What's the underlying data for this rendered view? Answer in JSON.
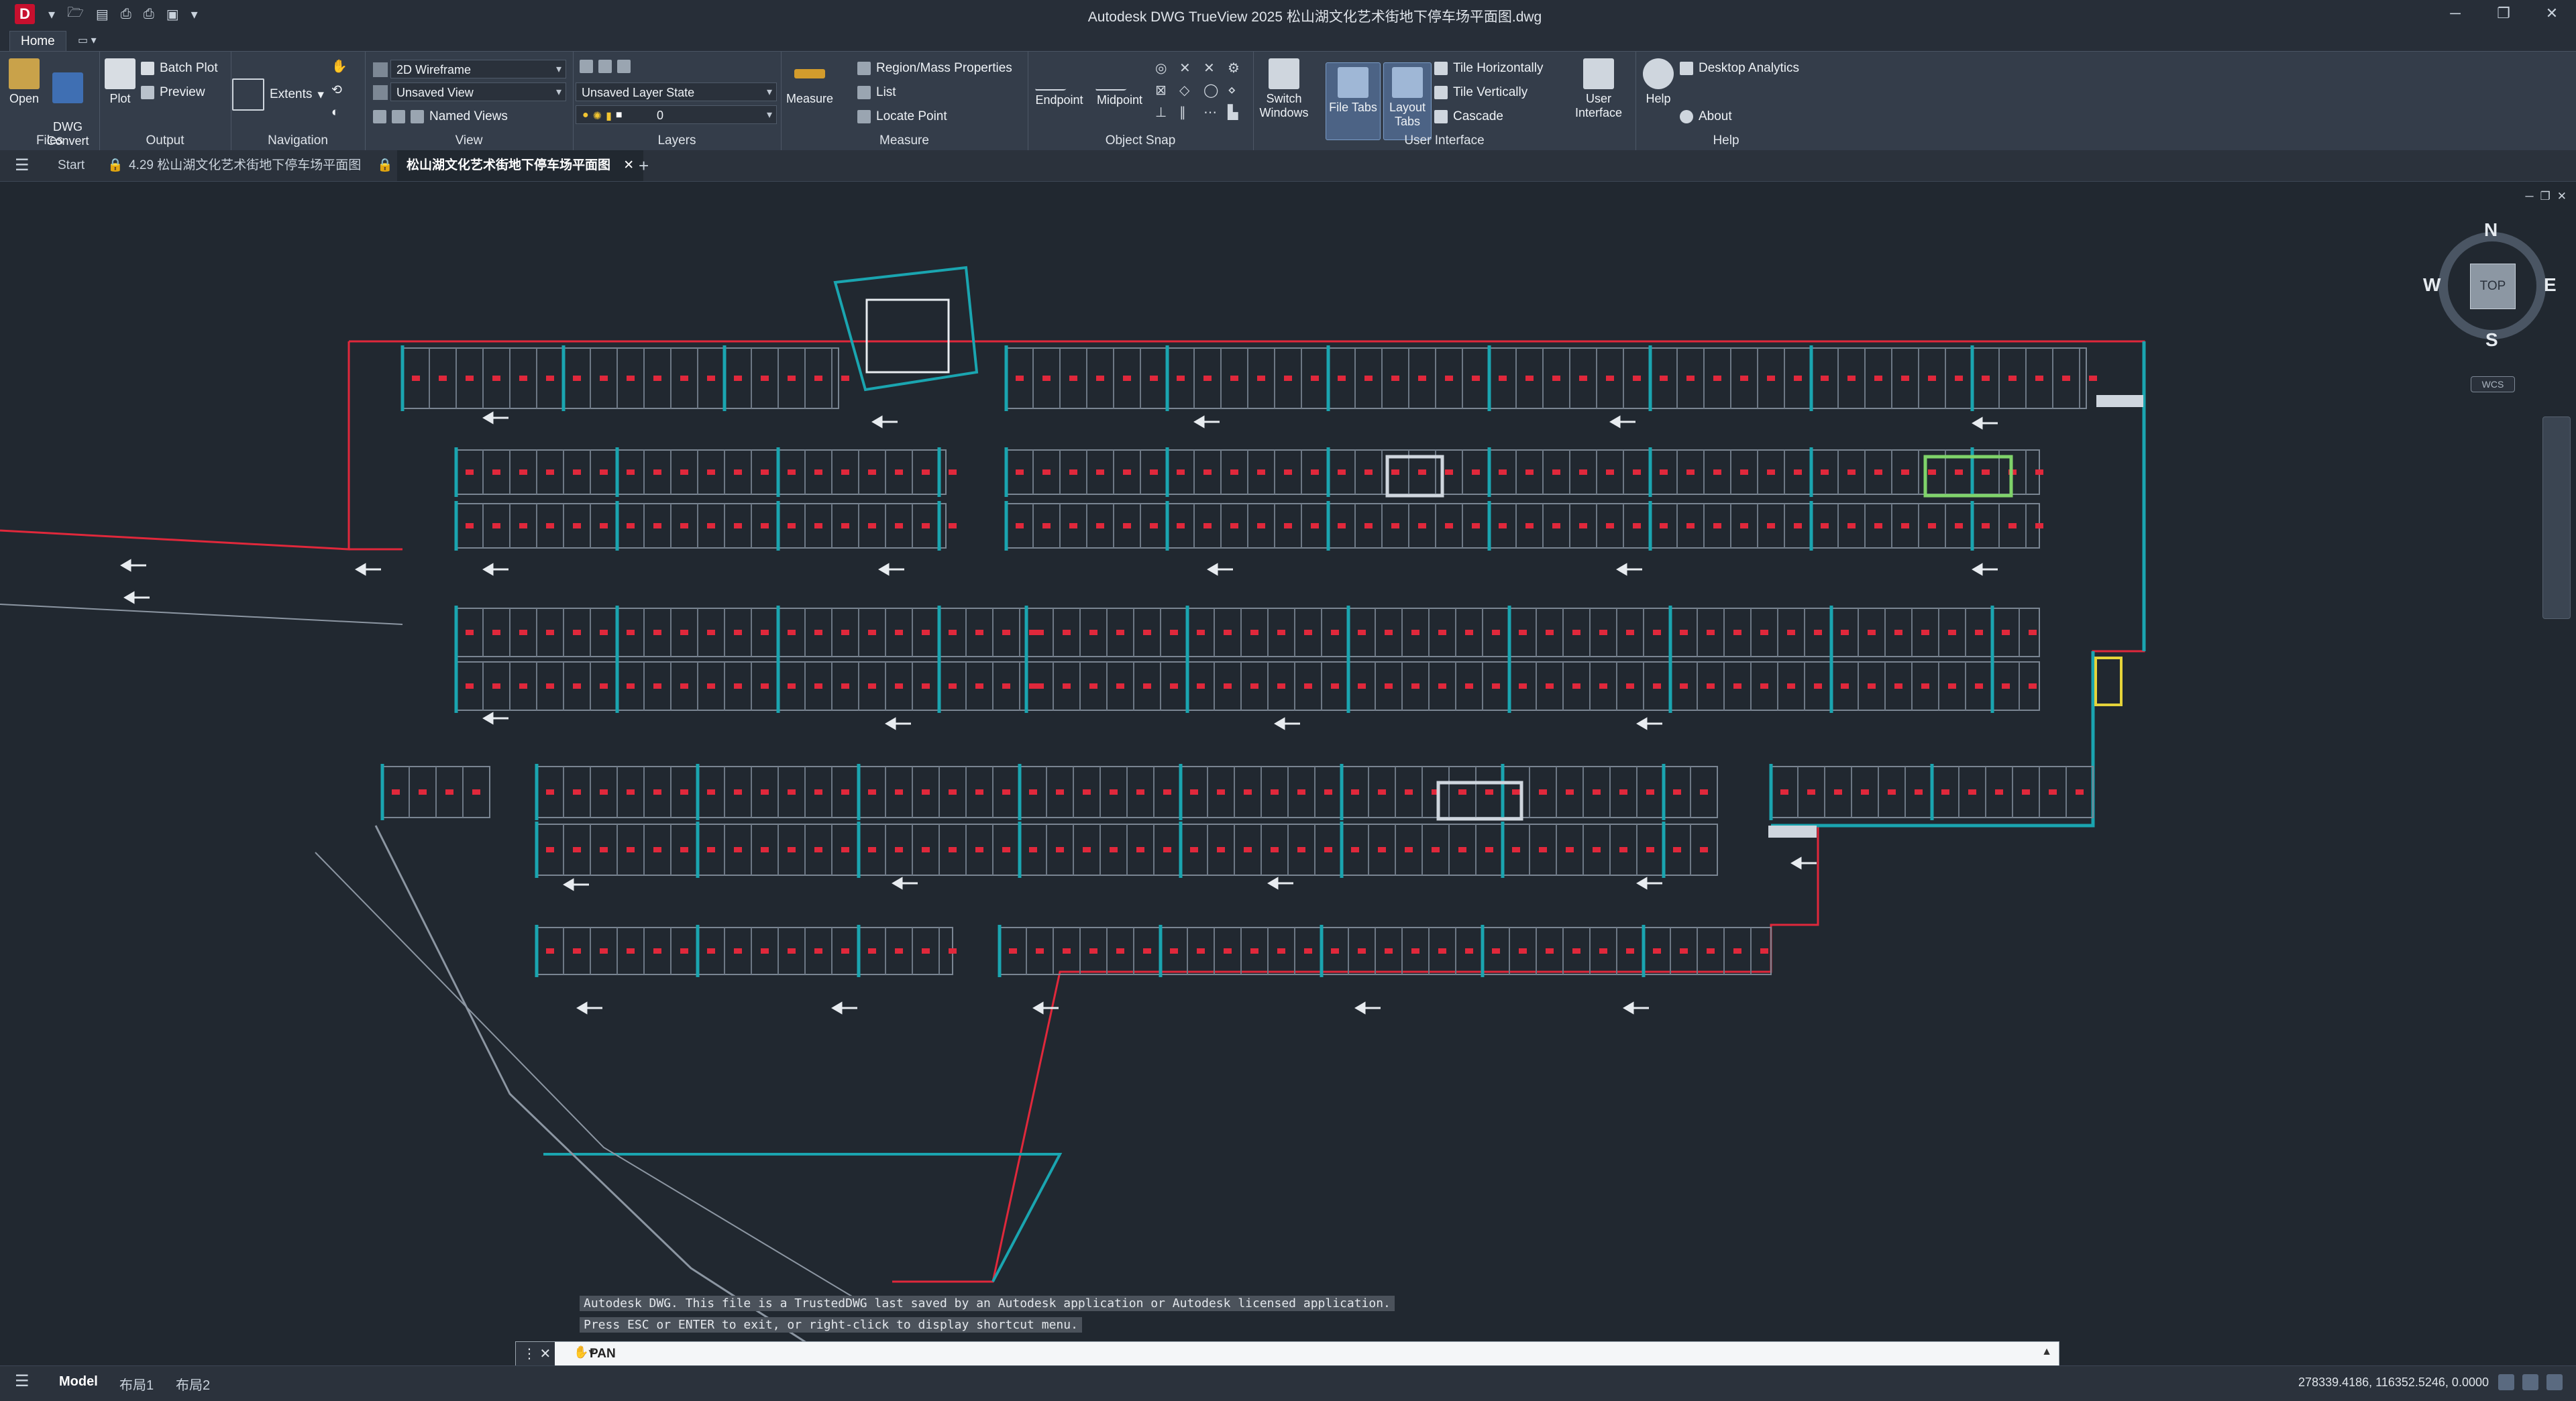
{
  "titlebar": {
    "app_logo": "D",
    "window_title": "Autodesk DWG TrueView 2025    松山湖文化艺术街地下停车场平面图.dwg",
    "controls": [
      "─",
      "❐",
      "✕"
    ]
  },
  "ribbon_tabs": {
    "home": "Home",
    "extra": "▭ ▾"
  },
  "ribbon": {
    "files": {
      "open": "Open",
      "dwg_convert": "DWG\nConvert",
      "label": "Files"
    },
    "output": {
      "plot": "Plot",
      "batch_plot": "Batch Plot",
      "preview": "Preview",
      "label": "Output"
    },
    "navigation": {
      "extents": "Extents",
      "label": "Navigation"
    },
    "view": {
      "visual_style": "2D Wireframe",
      "named_view": "Unsaved View",
      "named_views": "Named Views",
      "label": "View"
    },
    "layers": {
      "layer_state": "Unsaved Layer State",
      "layer": "0",
      "label": "Layers"
    },
    "measure": {
      "measure": "Measure",
      "region_mass": "Region/Mass Properties",
      "list": "List",
      "locate_point": "Locate Point",
      "label": "Measure"
    },
    "object_snap": {
      "endpoint": "Endpoint",
      "midpoint": "Midpoint",
      "label": "Object Snap"
    },
    "user_interface": {
      "switch_windows": "Switch Windows",
      "file_tabs": "File Tabs",
      "layout_tabs": "Layout Tabs",
      "tile_h": "Tile Horizontally",
      "tile_v": "Tile Vertically",
      "cascade": "Cascade",
      "user_interface": "User Interface",
      "label": "User Interface"
    },
    "help": {
      "help": "Help",
      "desktop_analytics": "Desktop Analytics",
      "about": "About",
      "label": "Help"
    }
  },
  "file_tabs": {
    "start": "Start",
    "file1": "4.29 松山湖文化艺术街地下停车场平面图",
    "file2": "松山湖文化艺术街地下停车场平面图",
    "add": "+"
  },
  "viewcube": {
    "top": "TOP",
    "n": "N",
    "s": "S",
    "e": "E",
    "w": "W",
    "wcs": "WCS"
  },
  "command": {
    "history": [
      "Autodesk DWG.  This file is a TrustedDWG last saved by an Autodesk application or Autodesk licensed application.",
      "Press ESC or ENTER to exit, or right-click to display shortcut menu."
    ],
    "current": "PAN"
  },
  "status": {
    "tabs": [
      "Model",
      "布局1",
      "布局2"
    ],
    "coordinates": "278339.4186, 116352.5246, 0.0000"
  },
  "colors": {
    "accent": "#1aa5b0",
    "parking_red": "#e0283b",
    "background": "#212830"
  }
}
